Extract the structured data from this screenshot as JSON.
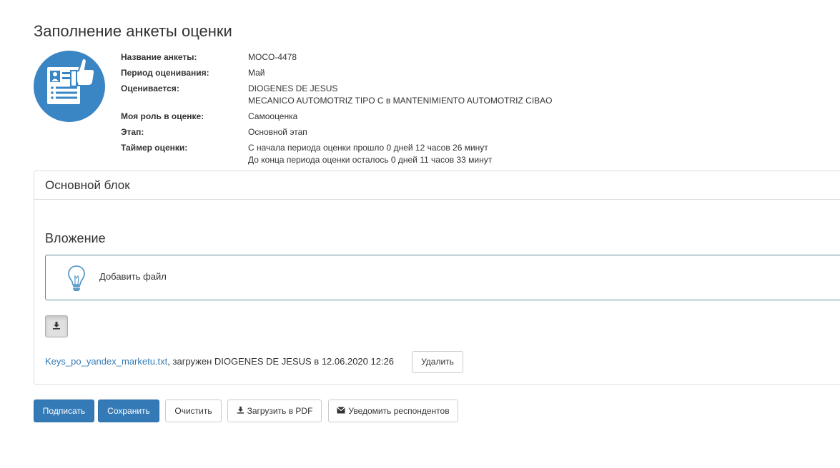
{
  "page": {
    "title": "Заполнение анкеты оценки"
  },
  "info": [
    {
      "label": "Название анкеты:",
      "value": [
        "MOCO-4478"
      ]
    },
    {
      "label": "Период оценивания:",
      "value": [
        "Май"
      ]
    },
    {
      "label": "Оценивается:",
      "value": [
        "DIOGENES DE JESUS",
        "MECANICO AUTOMOTRIZ TIPO C в MANTENIMIENTO AUTOMOTRIZ CIBAO"
      ]
    },
    {
      "label": "Моя роль в оценке:",
      "value": [
        "Самооценка"
      ]
    },
    {
      "label": "Этап:",
      "value": [
        "Основной этап"
      ]
    },
    {
      "label": "Таймер оценки:",
      "value": [
        "С начала периода оценки прошло 0 дней 12 часов 26 минут",
        "До конца периода оценки осталось 0 дней 11 часов 33 минут"
      ]
    }
  ],
  "panel": {
    "heading": "Основной блок",
    "section_title": "Вложение",
    "dropzone_text": "Добавить файл",
    "dropzone_icon": "lightbulb-icon",
    "upload_icon": "download-icon",
    "file": {
      "name": "Keys_po_yandex_marketu.txt",
      "info": ", загружен DIOGENES DE JESUS в 12.06.2020 12:26",
      "delete_label": "Удалить"
    }
  },
  "actions": {
    "sign": "Подписать",
    "save": "Сохранить",
    "clear": "Очистить",
    "pdf": "Загрузить в PDF",
    "notify": "Уведомить респондентов"
  },
  "colors": {
    "primary": "#337ab7",
    "logo": "#3a85c4",
    "link": "#337ab7"
  }
}
